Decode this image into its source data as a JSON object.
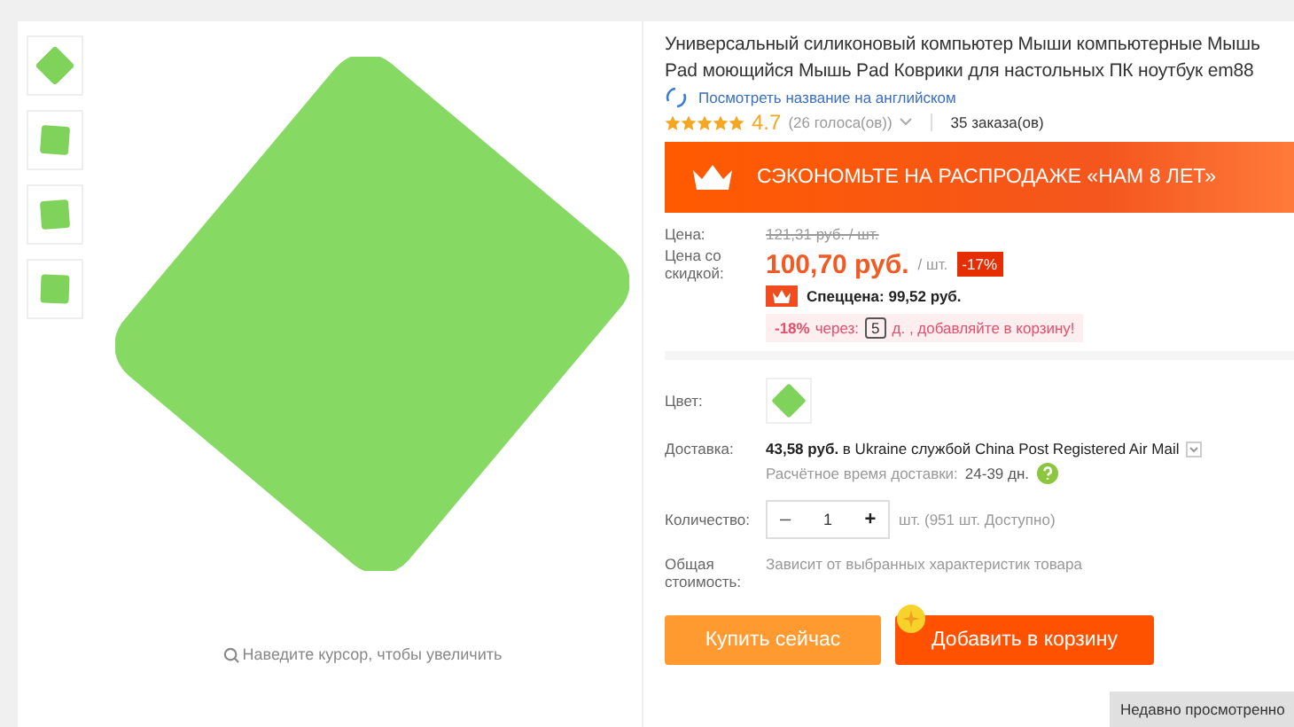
{
  "gallery": {
    "thumbnails": [
      {
        "kind": "diamond"
      },
      {
        "kind": "tilted"
      },
      {
        "kind": "upright"
      },
      {
        "kind": "square"
      }
    ],
    "zoom_hint": "Наведите курсор, чтобы увеличить"
  },
  "product": {
    "title": "Универсальный силиконовый компьютер Мыши компьютерные Мышь Pad моющийся Мышь Pad Коврики для настольных ПК ноутбук em88",
    "translate_link": "Посмотреть название на английском",
    "stars": 5,
    "rating": "4.7",
    "votes": "(26 голоса(ов))",
    "orders": "35 заказа(ов)",
    "promo_banner": "СЭКОНОМЬТЕ НА РАСПРОДАЖЕ «НАМ 8 ЛЕТ»",
    "price_label": "Цена:",
    "old_price": "121,31 руб. / шт.",
    "discount_label": "Цена со скидкой:",
    "price": "100,70 руб.",
    "unit": "/ шт.",
    "discount_badge": "-17%",
    "special_price": "Спеццена: 99,52 руб.",
    "countdown": {
      "percent": "-18%",
      "via": "через:",
      "days": "5",
      "text": "д. , добавляйте в корзину!"
    },
    "color_label": "Цвет:",
    "delivery_label": "Доставка:",
    "delivery": "**43,58 руб.** в Ukraine службой China Post Registered Air Mail",
    "delivery_time_label": "Расчётное время доставки:",
    "delivery_time": "24-39 дн.",
    "quantity_label": "Количество:",
    "quantity": {
      "minus": "–",
      "value": "1",
      "plus": "+"
    },
    "stock": "шт. (951 шт. Доступно)",
    "total_label": "Общая стоимость:",
    "total": "Зависит от выбранных характеристик товара",
    "buttons": [
      {
        "kind": "buy",
        "label": "Купить сейчас"
      },
      {
        "kind": "cart",
        "label": "Добавить в корзину"
      }
    ]
  },
  "recently_viewed": "Недавно просмотренно"
}
